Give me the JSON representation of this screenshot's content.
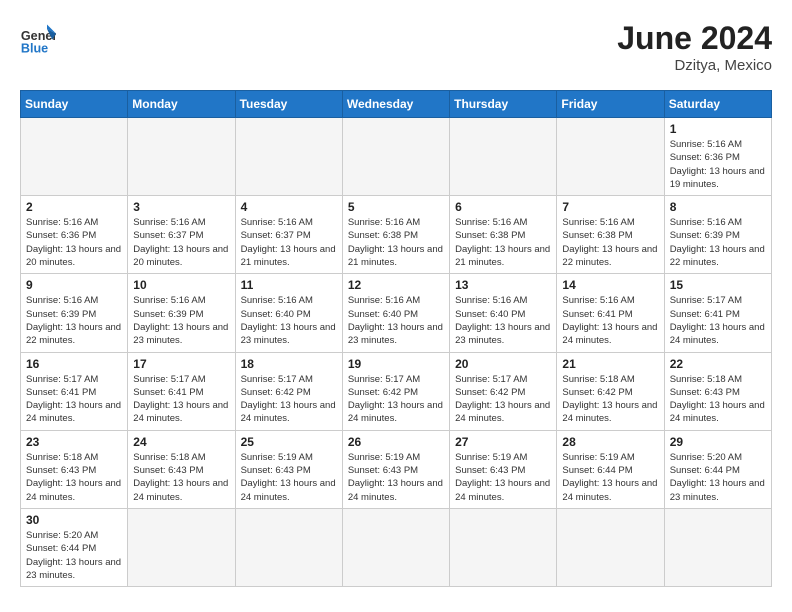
{
  "header": {
    "logo_general": "General",
    "logo_blue": "Blue",
    "title": "June 2024",
    "subtitle": "Dzitya, Mexico"
  },
  "days_of_week": [
    "Sunday",
    "Monday",
    "Tuesday",
    "Wednesday",
    "Thursday",
    "Friday",
    "Saturday"
  ],
  "weeks": [
    [
      {
        "day": "",
        "empty": true
      },
      {
        "day": "",
        "empty": true
      },
      {
        "day": "",
        "empty": true
      },
      {
        "day": "",
        "empty": true
      },
      {
        "day": "",
        "empty": true
      },
      {
        "day": "",
        "empty": true
      },
      {
        "day": "1",
        "sunrise": "Sunrise: 5:16 AM",
        "sunset": "Sunset: 6:36 PM",
        "daylight": "Daylight: 13 hours and 19 minutes."
      }
    ],
    [
      {
        "day": "2",
        "sunrise": "Sunrise: 5:16 AM",
        "sunset": "Sunset: 6:36 PM",
        "daylight": "Daylight: 13 hours and 20 minutes."
      },
      {
        "day": "3",
        "sunrise": "Sunrise: 5:16 AM",
        "sunset": "Sunset: 6:37 PM",
        "daylight": "Daylight: 13 hours and 20 minutes."
      },
      {
        "day": "4",
        "sunrise": "Sunrise: 5:16 AM",
        "sunset": "Sunset: 6:37 PM",
        "daylight": "Daylight: 13 hours and 21 minutes."
      },
      {
        "day": "5",
        "sunrise": "Sunrise: 5:16 AM",
        "sunset": "Sunset: 6:38 PM",
        "daylight": "Daylight: 13 hours and 21 minutes."
      },
      {
        "day": "6",
        "sunrise": "Sunrise: 5:16 AM",
        "sunset": "Sunset: 6:38 PM",
        "daylight": "Daylight: 13 hours and 21 minutes."
      },
      {
        "day": "7",
        "sunrise": "Sunrise: 5:16 AM",
        "sunset": "Sunset: 6:38 PM",
        "daylight": "Daylight: 13 hours and 22 minutes."
      },
      {
        "day": "8",
        "sunrise": "Sunrise: 5:16 AM",
        "sunset": "Sunset: 6:39 PM",
        "daylight": "Daylight: 13 hours and 22 minutes."
      }
    ],
    [
      {
        "day": "9",
        "sunrise": "Sunrise: 5:16 AM",
        "sunset": "Sunset: 6:39 PM",
        "daylight": "Daylight: 13 hours and 22 minutes."
      },
      {
        "day": "10",
        "sunrise": "Sunrise: 5:16 AM",
        "sunset": "Sunset: 6:39 PM",
        "daylight": "Daylight: 13 hours and 23 minutes."
      },
      {
        "day": "11",
        "sunrise": "Sunrise: 5:16 AM",
        "sunset": "Sunset: 6:40 PM",
        "daylight": "Daylight: 13 hours and 23 minutes."
      },
      {
        "day": "12",
        "sunrise": "Sunrise: 5:16 AM",
        "sunset": "Sunset: 6:40 PM",
        "daylight": "Daylight: 13 hours and 23 minutes."
      },
      {
        "day": "13",
        "sunrise": "Sunrise: 5:16 AM",
        "sunset": "Sunset: 6:40 PM",
        "daylight": "Daylight: 13 hours and 23 minutes."
      },
      {
        "day": "14",
        "sunrise": "Sunrise: 5:16 AM",
        "sunset": "Sunset: 6:41 PM",
        "daylight": "Daylight: 13 hours and 24 minutes."
      },
      {
        "day": "15",
        "sunrise": "Sunrise: 5:17 AM",
        "sunset": "Sunset: 6:41 PM",
        "daylight": "Daylight: 13 hours and 24 minutes."
      }
    ],
    [
      {
        "day": "16",
        "sunrise": "Sunrise: 5:17 AM",
        "sunset": "Sunset: 6:41 PM",
        "daylight": "Daylight: 13 hours and 24 minutes."
      },
      {
        "day": "17",
        "sunrise": "Sunrise: 5:17 AM",
        "sunset": "Sunset: 6:41 PM",
        "daylight": "Daylight: 13 hours and 24 minutes."
      },
      {
        "day": "18",
        "sunrise": "Sunrise: 5:17 AM",
        "sunset": "Sunset: 6:42 PM",
        "daylight": "Daylight: 13 hours and 24 minutes."
      },
      {
        "day": "19",
        "sunrise": "Sunrise: 5:17 AM",
        "sunset": "Sunset: 6:42 PM",
        "daylight": "Daylight: 13 hours and 24 minutes."
      },
      {
        "day": "20",
        "sunrise": "Sunrise: 5:17 AM",
        "sunset": "Sunset: 6:42 PM",
        "daylight": "Daylight: 13 hours and 24 minutes."
      },
      {
        "day": "21",
        "sunrise": "Sunrise: 5:18 AM",
        "sunset": "Sunset: 6:42 PM",
        "daylight": "Daylight: 13 hours and 24 minutes."
      },
      {
        "day": "22",
        "sunrise": "Sunrise: 5:18 AM",
        "sunset": "Sunset: 6:43 PM",
        "daylight": "Daylight: 13 hours and 24 minutes."
      }
    ],
    [
      {
        "day": "23",
        "sunrise": "Sunrise: 5:18 AM",
        "sunset": "Sunset: 6:43 PM",
        "daylight": "Daylight: 13 hours and 24 minutes."
      },
      {
        "day": "24",
        "sunrise": "Sunrise: 5:18 AM",
        "sunset": "Sunset: 6:43 PM",
        "daylight": "Daylight: 13 hours and 24 minutes."
      },
      {
        "day": "25",
        "sunrise": "Sunrise: 5:19 AM",
        "sunset": "Sunset: 6:43 PM",
        "daylight": "Daylight: 13 hours and 24 minutes."
      },
      {
        "day": "26",
        "sunrise": "Sunrise: 5:19 AM",
        "sunset": "Sunset: 6:43 PM",
        "daylight": "Daylight: 13 hours and 24 minutes."
      },
      {
        "day": "27",
        "sunrise": "Sunrise: 5:19 AM",
        "sunset": "Sunset: 6:43 PM",
        "daylight": "Daylight: 13 hours and 24 minutes."
      },
      {
        "day": "28",
        "sunrise": "Sunrise: 5:19 AM",
        "sunset": "Sunset: 6:44 PM",
        "daylight": "Daylight: 13 hours and 24 minutes."
      },
      {
        "day": "29",
        "sunrise": "Sunrise: 5:20 AM",
        "sunset": "Sunset: 6:44 PM",
        "daylight": "Daylight: 13 hours and 23 minutes."
      }
    ],
    [
      {
        "day": "30",
        "sunrise": "Sunrise: 5:20 AM",
        "sunset": "Sunset: 6:44 PM",
        "daylight": "Daylight: 13 hours and 23 minutes."
      },
      {
        "day": "",
        "empty": true
      },
      {
        "day": "",
        "empty": true
      },
      {
        "day": "",
        "empty": true
      },
      {
        "day": "",
        "empty": true
      },
      {
        "day": "",
        "empty": true
      },
      {
        "day": "",
        "empty": true
      }
    ]
  ]
}
